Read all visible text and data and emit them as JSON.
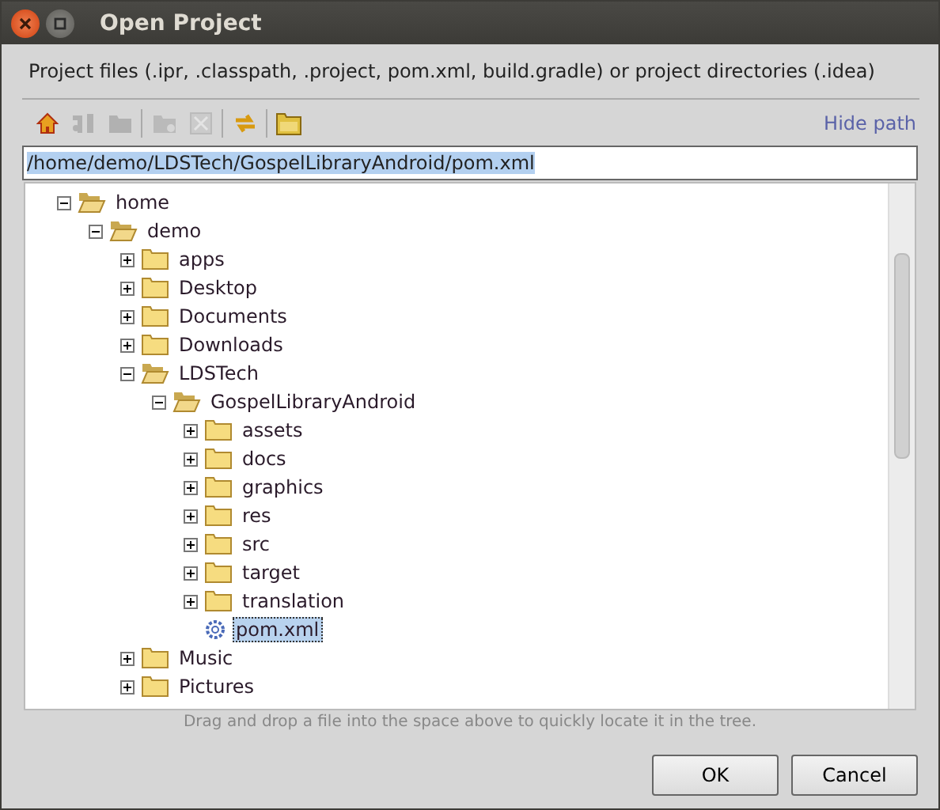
{
  "window": {
    "title": "Open Project"
  },
  "description": "Project files (.ipr, .classpath, .project, pom.xml, build.gradle) or project directories (.idea)",
  "toolbar": [
    {
      "kind": "home",
      "disabled": false
    },
    {
      "kind": "module",
      "disabled": true
    },
    {
      "kind": "folder",
      "disabled": true
    },
    {
      "kind": "new-folder",
      "disabled": true
    },
    {
      "kind": "delete",
      "disabled": true
    },
    {
      "kind": "refresh",
      "disabled": false
    },
    {
      "kind": "show-folder",
      "disabled": false
    }
  ],
  "hide_path_link": "Hide path",
  "path_field": {
    "value": "/home/demo/LDSTech/GospelLibraryAndroid/pom.xml",
    "selected": true
  },
  "tree": [
    {
      "label": "home",
      "kind": "folder",
      "expanded": true,
      "selected": false,
      "children": [
        {
          "label": "demo",
          "kind": "folder",
          "expanded": true,
          "selected": false,
          "children": [
            {
              "label": "apps",
              "kind": "folder",
              "expanded": false,
              "selected": false
            },
            {
              "label": "Desktop",
              "kind": "folder",
              "expanded": false,
              "selected": false
            },
            {
              "label": "Documents",
              "kind": "folder",
              "expanded": false,
              "selected": false
            },
            {
              "label": "Downloads",
              "kind": "folder",
              "expanded": false,
              "selected": false
            },
            {
              "label": "LDSTech",
              "kind": "folder",
              "expanded": true,
              "selected": false,
              "children": [
                {
                  "label": "GospelLibraryAndroid",
                  "kind": "folder",
                  "expanded": true,
                  "selected": false,
                  "children": [
                    {
                      "label": "assets",
                      "kind": "folder",
                      "expanded": false,
                      "selected": false
                    },
                    {
                      "label": "docs",
                      "kind": "folder",
                      "expanded": false,
                      "selected": false
                    },
                    {
                      "label": "graphics",
                      "kind": "folder",
                      "expanded": false,
                      "selected": false
                    },
                    {
                      "label": "res",
                      "kind": "folder",
                      "expanded": false,
                      "selected": false
                    },
                    {
                      "label": "src",
                      "kind": "folder",
                      "expanded": false,
                      "selected": false
                    },
                    {
                      "label": "target",
                      "kind": "folder",
                      "expanded": false,
                      "selected": false
                    },
                    {
                      "label": "translation",
                      "kind": "folder",
                      "expanded": false,
                      "selected": false
                    },
                    {
                      "label": "pom.xml",
                      "kind": "file",
                      "selected": true
                    }
                  ]
                }
              ]
            },
            {
              "label": "Music",
              "kind": "folder",
              "expanded": false,
              "selected": false
            },
            {
              "label": "Pictures",
              "kind": "folder",
              "expanded": false,
              "selected": false
            }
          ]
        }
      ]
    }
  ],
  "hint": "Drag and drop a file into the space above to quickly locate it in the tree.",
  "buttons": [
    "OK",
    "Cancel"
  ]
}
